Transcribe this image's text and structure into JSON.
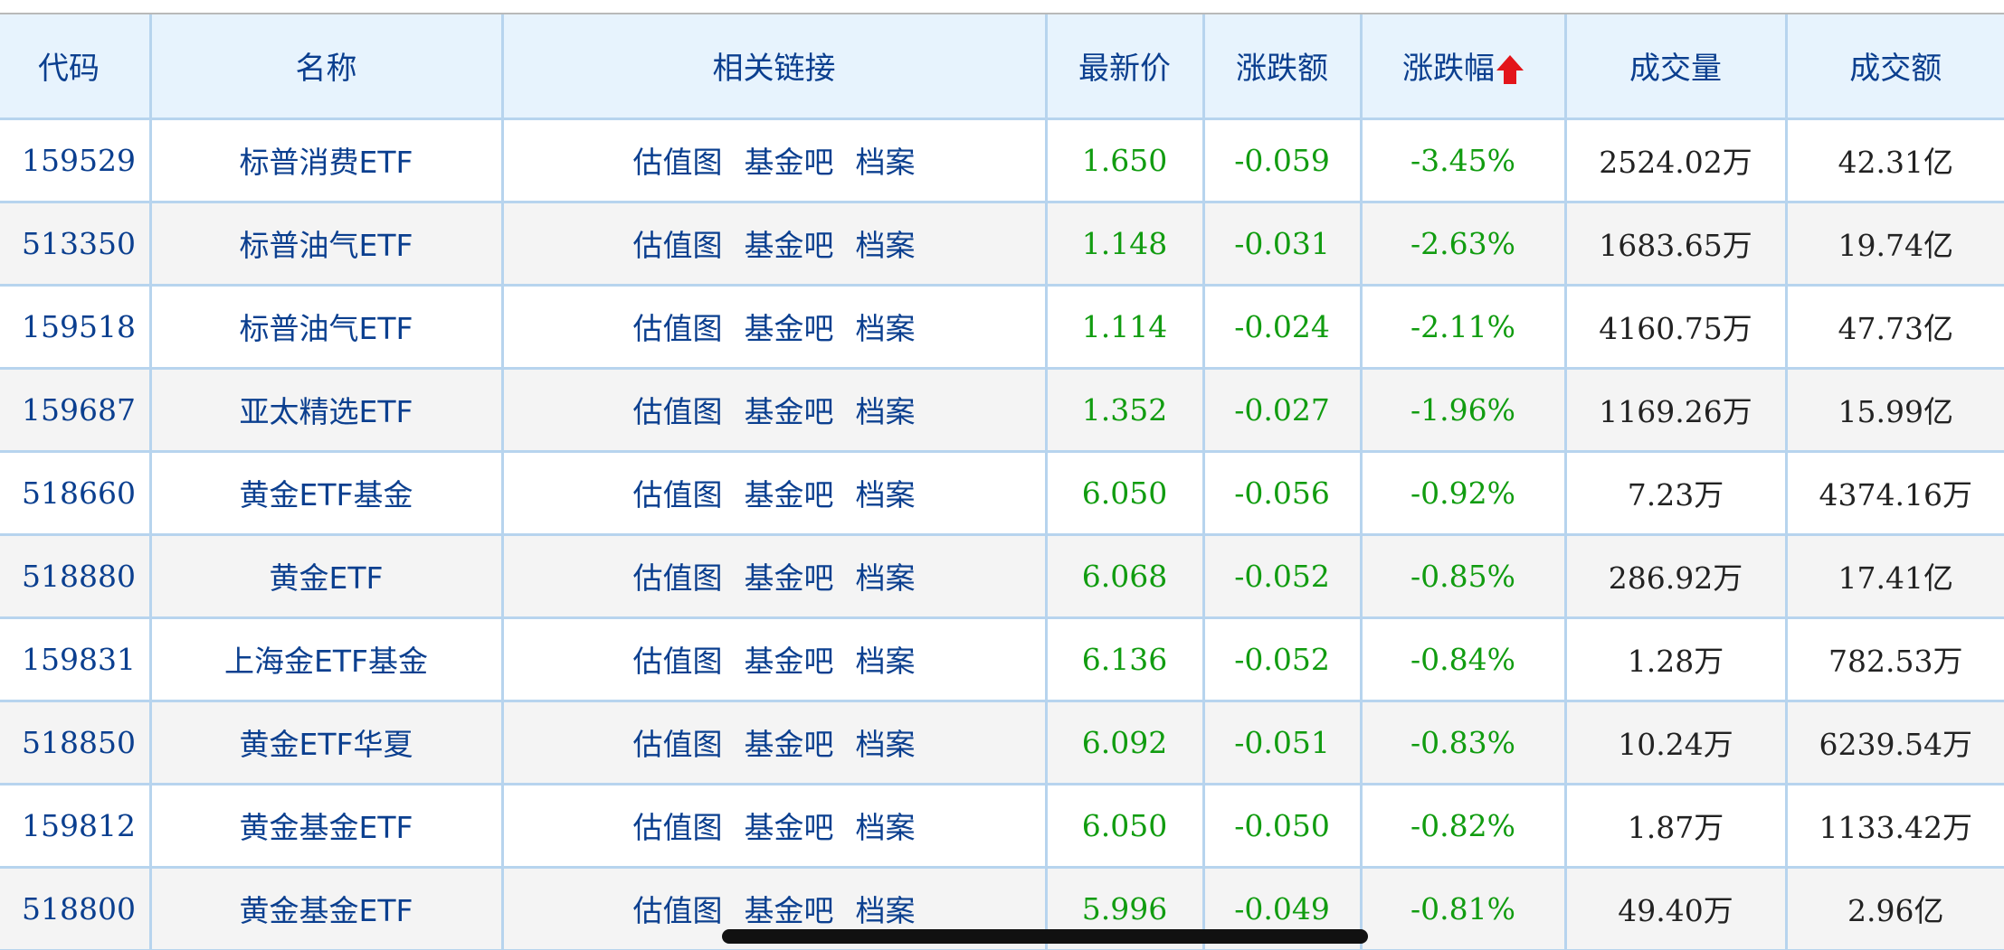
{
  "colors": {
    "header_bg": "#e7f3fd",
    "header_text": "#0b3f8f",
    "grid_line": "#b7d4ee",
    "negative_green": "#119c10",
    "sort_arrow_red": "#e3141a",
    "row_alt_bg": "#f4f4f4"
  },
  "header": {
    "code": "代码",
    "name": "名称",
    "links": "相关链接",
    "price": "最新价",
    "change": "涨跌额",
    "pct": "涨跌幅",
    "volume": "成交量",
    "amount": "成交额",
    "sort_icon": "sort-up-arrow-icon"
  },
  "rows": [
    {
      "code": "159529",
      "name": "标普消费ETF",
      "link1": "估值图",
      "link2": "基金吧",
      "link3": "档案",
      "price": "1.650",
      "change": "-0.059",
      "pct": "-3.45%",
      "volume": "2524.02万",
      "amount": "42.31亿"
    },
    {
      "code": "513350",
      "name": "标普油气ETF",
      "link1": "估值图",
      "link2": "基金吧",
      "link3": "档案",
      "price": "1.148",
      "change": "-0.031",
      "pct": "-2.63%",
      "volume": "1683.65万",
      "amount": "19.74亿"
    },
    {
      "code": "159518",
      "name": "标普油气ETF",
      "link1": "估值图",
      "link2": "基金吧",
      "link3": "档案",
      "price": "1.114",
      "change": "-0.024",
      "pct": "-2.11%",
      "volume": "4160.75万",
      "amount": "47.73亿"
    },
    {
      "code": "159687",
      "name": "亚太精选ETF",
      "link1": "估值图",
      "link2": "基金吧",
      "link3": "档案",
      "price": "1.352",
      "change": "-0.027",
      "pct": "-1.96%",
      "volume": "1169.26万",
      "amount": "15.99亿"
    },
    {
      "code": "518660",
      "name": "黄金ETF基金",
      "link1": "估值图",
      "link2": "基金吧",
      "link3": "档案",
      "price": "6.050",
      "change": "-0.056",
      "pct": "-0.92%",
      "volume": "7.23万",
      "amount": "4374.16万"
    },
    {
      "code": "518880",
      "name": "黄金ETF",
      "link1": "估值图",
      "link2": "基金吧",
      "link3": "档案",
      "price": "6.068",
      "change": "-0.052",
      "pct": "-0.85%",
      "volume": "286.92万",
      "amount": "17.41亿"
    },
    {
      "code": "159831",
      "name": "上海金ETF基金",
      "link1": "估值图",
      "link2": "基金吧",
      "link3": "档案",
      "price": "6.136",
      "change": "-0.052",
      "pct": "-0.84%",
      "volume": "1.28万",
      "amount": "782.53万"
    },
    {
      "code": "518850",
      "name": "黄金ETF华夏",
      "link1": "估值图",
      "link2": "基金吧",
      "link3": "档案",
      "price": "6.092",
      "change": "-0.051",
      "pct": "-0.83%",
      "volume": "10.24万",
      "amount": "6239.54万"
    },
    {
      "code": "159812",
      "name": "黄金基金ETF",
      "link1": "估值图",
      "link2": "基金吧",
      "link3": "档案",
      "price": "6.050",
      "change": "-0.050",
      "pct": "-0.82%",
      "volume": "1.87万",
      "amount": "1133.42万"
    },
    {
      "code": "518800",
      "name": "黄金基金ETF",
      "link1": "估值图",
      "link2": "基金吧",
      "link3": "档案",
      "price": "5.996",
      "change": "-0.049",
      "pct": "-0.81%",
      "volume": "49.40万",
      "amount": "2.96亿"
    }
  ]
}
